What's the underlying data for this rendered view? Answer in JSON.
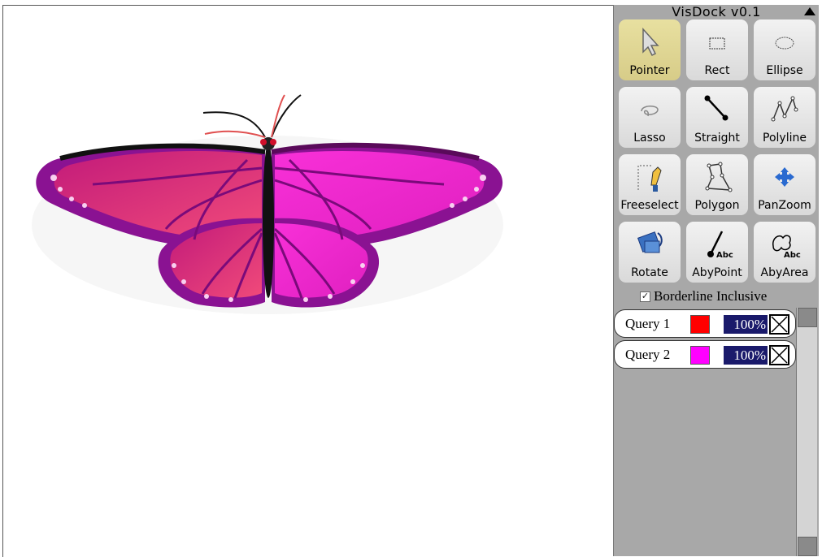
{
  "dock": {
    "title": "VisDock v0.1",
    "tools": [
      {
        "label": "Pointer",
        "icon": "pointer-icon",
        "active": true
      },
      {
        "label": "Rect",
        "icon": "rect-icon"
      },
      {
        "label": "Ellipse",
        "icon": "ellipse-icon"
      },
      {
        "label": "Lasso",
        "icon": "lasso-icon"
      },
      {
        "label": "Straight",
        "icon": "straight-line-icon"
      },
      {
        "label": "Polyline",
        "icon": "polyline-icon"
      },
      {
        "label": "Freeselect",
        "icon": "freeselect-icon"
      },
      {
        "label": "Polygon",
        "icon": "polygon-icon"
      },
      {
        "label": "PanZoom",
        "icon": "panzoom-icon"
      },
      {
        "label": "Rotate",
        "icon": "rotate-icon"
      },
      {
        "label": "AbyPoint",
        "icon": "annotate-by-point-icon"
      },
      {
        "label": "AbyArea",
        "icon": "annotate-by-area-icon"
      }
    ],
    "borderline": {
      "label": "Borderline Inclusive",
      "checked": true
    },
    "queries": [
      {
        "label": "Query 1",
        "color": "#ff0000",
        "opacity": "100%"
      },
      {
        "label": "Query 2",
        "color": "#ff00ff",
        "opacity": "100%"
      }
    ]
  },
  "canvas": {
    "image": "butterfly",
    "colors": {
      "left_wing": "#e8407a",
      "right_wing": "#f026c8",
      "wing_edge": "#7a0a7a"
    }
  },
  "colors": {
    "dock_bg": "#a8a8a8",
    "active_tool": "#e0d890",
    "opacity_bg": "#1a1a6b"
  }
}
